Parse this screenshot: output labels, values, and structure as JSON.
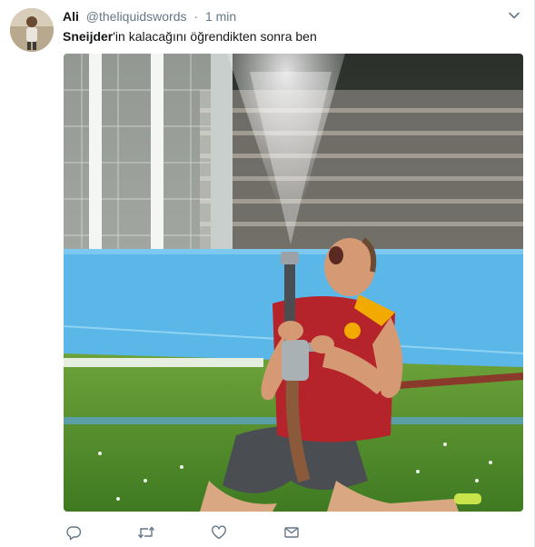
{
  "tweet": {
    "author_name": "Ali",
    "handle": "@theliquidswords",
    "separator": "·",
    "time": "1 min",
    "text_bold": "Sneijder",
    "text_rest": "'in kalacağını öğrendikten sonra ben"
  },
  "icons": {
    "more": "chevron-down-icon",
    "reply": "reply-icon",
    "retweet": "retweet-icon",
    "like": "heart-icon",
    "dm": "envelope-icon"
  },
  "colors": {
    "text": "#14171a",
    "secondary": "#657786",
    "icon": "#657786",
    "jersey_red": "#b5232b",
    "jersey_yellow": "#f2a900",
    "track_blue": "#5bb7e8",
    "grass": "#4f8a2a"
  }
}
